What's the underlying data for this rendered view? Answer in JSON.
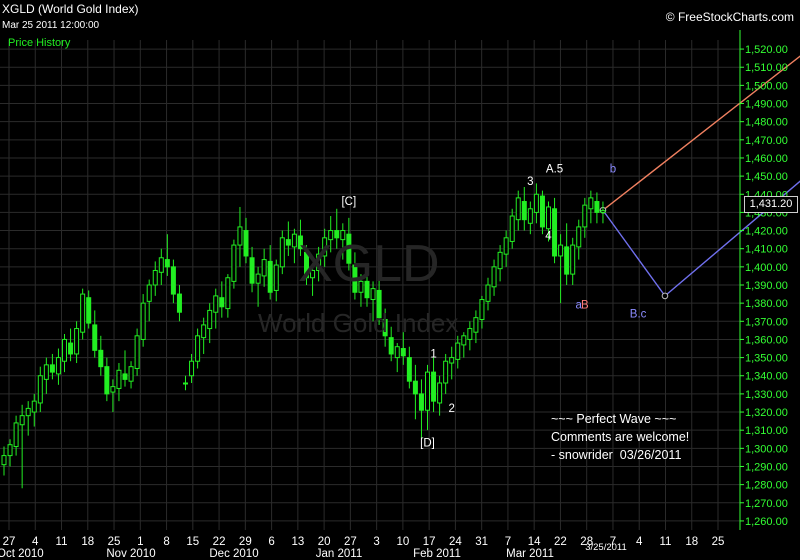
{
  "header": {
    "symbol_title": "XGLD (World Gold Index)",
    "timestamp": "Mar 25 2011 12:00:00",
    "panel_label": "Price History",
    "brand": "© FreeStockCharts.com"
  },
  "watermark": {
    "symbol": "XGLD",
    "name": "World Gold Index"
  },
  "last_price_label": "1,431.20",
  "note_lines": [
    "~~~ Perfect Wave ~~~",
    "Comments are welcome!",
    "- snowrider  03/26/2011"
  ],
  "colors": {
    "background": "#000000",
    "candles": "#22ee22",
    "grid": "#2b2b2b",
    "axis_text": "#33ff33",
    "projection_up": "#f08060",
    "projection_alt": "#7070ee",
    "label_blue": "#8c8cff",
    "label_red": "#ff7a7a"
  },
  "chart_data": {
    "type": "candlestick",
    "ylim": [
      1255,
      1525
    ],
    "y_ticks": [
      1260,
      1270,
      1280,
      1290,
      1300,
      1310,
      1320,
      1330,
      1340,
      1350,
      1360,
      1370,
      1380,
      1390,
      1400,
      1410,
      1420,
      1430,
      1440,
      1450,
      1460,
      1470,
      1480,
      1490,
      1500,
      1510,
      1520
    ],
    "y_tick_labels": [
      "1,260.00",
      "1,270.00",
      "1,280.00",
      "1,290.00",
      "1,300.00",
      "1,310.00",
      "1,320.00",
      "1,330.00",
      "1,340.00",
      "1,350.00",
      "1,360.00",
      "1,370.00",
      "1,380.00",
      "1,390.00",
      "1,400.00",
      "1,410.00",
      "1,420.00",
      "1,430.00",
      "1,440.00",
      "1,450.00",
      "1,460.00",
      "1,470.00",
      "1,480.00",
      "1,490.00",
      "1,500.00",
      "1,510.00",
      "1,520.00"
    ],
    "x_day_ticks": [
      "27",
      "4",
      "11",
      "18",
      "25",
      "1",
      "8",
      "15",
      "22",
      "29",
      "6",
      "13",
      "20",
      "27",
      "3",
      "10",
      "17",
      "24",
      "31",
      "7",
      "14",
      "22",
      "28",
      "7",
      "4",
      "11",
      "18",
      "25"
    ],
    "month_labels": [
      "Oct 2010",
      "Nov 2010",
      "Dec 2010",
      "Jan 2011",
      "Feb 2011",
      "Mar 2011"
    ],
    "date_marker": "3/25/2011",
    "last_price": 1431.2,
    "ohlc": [
      [
        1291,
        1301,
        1285,
        1296
      ],
      [
        1296,
        1305,
        1290,
        1302
      ],
      [
        1301,
        1318,
        1296,
        1314
      ],
      [
        1313,
        1324,
        1278,
        1318
      ],
      [
        1318,
        1326,
        1307,
        1322
      ],
      [
        1320,
        1330,
        1312,
        1326
      ],
      [
        1325,
        1345,
        1320,
        1340
      ],
      [
        1338,
        1350,
        1330,
        1346
      ],
      [
        1346,
        1352,
        1338,
        1342
      ],
      [
        1341,
        1355,
        1335,
        1350
      ],
      [
        1348,
        1363,
        1342,
        1360
      ],
      [
        1358,
        1366,
        1348,
        1352
      ],
      [
        1352,
        1370,
        1347,
        1366
      ],
      [
        1364,
        1388,
        1360,
        1385
      ],
      [
        1383,
        1387,
        1366,
        1369
      ],
      [
        1368,
        1376,
        1350,
        1354
      ],
      [
        1354,
        1362,
        1340,
        1345
      ],
      [
        1345,
        1350,
        1326,
        1330
      ],
      [
        1331,
        1338,
        1320,
        1334
      ],
      [
        1333,
        1347,
        1326,
        1343
      ],
      [
        1341,
        1354,
        1334,
        1338
      ],
      [
        1337,
        1348,
        1333,
        1345
      ],
      [
        1344,
        1366,
        1340,
        1362
      ],
      [
        1360,
        1385,
        1356,
        1380
      ],
      [
        1381,
        1393,
        1370,
        1390
      ],
      [
        1390,
        1403,
        1384,
        1398
      ],
      [
        1397,
        1410,
        1390,
        1405
      ],
      [
        1404,
        1418,
        1395,
        1400
      ],
      [
        1400,
        1404,
        1380,
        1385
      ],
      [
        1385,
        1390,
        1370,
        1375
      ],
      [
        1336,
        1340,
        1332,
        1336
      ],
      [
        1340,
        1352,
        1336,
        1348
      ],
      [
        1348,
        1366,
        1344,
        1362
      ],
      [
        1361,
        1372,
        1352,
        1368
      ],
      [
        1366,
        1380,
        1358,
        1376
      ],
      [
        1375,
        1388,
        1366,
        1384
      ],
      [
        1383,
        1392,
        1372,
        1378
      ],
      [
        1377,
        1396,
        1372,
        1394
      ],
      [
        1392,
        1415,
        1388,
        1412
      ],
      [
        1412,
        1433,
        1400,
        1422
      ],
      [
        1420,
        1427,
        1402,
        1406
      ],
      [
        1405,
        1411,
        1386,
        1391
      ],
      [
        1391,
        1400,
        1378,
        1396
      ],
      [
        1395,
        1410,
        1389,
        1404
      ],
      [
        1403,
        1412,
        1382,
        1386
      ],
      [
        1387,
        1404,
        1381,
        1401
      ],
      [
        1400,
        1420,
        1396,
        1416
      ],
      [
        1415,
        1425,
        1406,
        1412
      ],
      [
        1411,
        1421,
        1402,
        1418
      ],
      [
        1417,
        1426,
        1406,
        1410
      ],
      [
        1408,
        1412,
        1390,
        1394
      ],
      [
        1394,
        1402,
        1384,
        1398
      ],
      [
        1398,
        1411,
        1392,
        1407
      ],
      [
        1406,
        1421,
        1400,
        1416
      ],
      [
        1415,
        1428,
        1408,
        1420
      ],
      [
        1420,
        1432,
        1410,
        1416
      ],
      [
        1415,
        1424,
        1404,
        1420
      ],
      [
        1418,
        1427,
        1398,
        1402
      ],
      [
        1401,
        1408,
        1382,
        1386
      ],
      [
        1386,
        1396,
        1378,
        1392
      ],
      [
        1392,
        1399,
        1378,
        1383
      ],
      [
        1382,
        1392,
        1370,
        1388
      ],
      [
        1387,
        1393,
        1368,
        1372
      ],
      [
        1371,
        1377,
        1356,
        1362
      ],
      [
        1361,
        1367,
        1348,
        1352
      ],
      [
        1350,
        1358,
        1342,
        1356
      ],
      [
        1355,
        1364,
        1346,
        1351
      ],
      [
        1350,
        1356,
        1333,
        1337
      ],
      [
        1337,
        1346,
        1316,
        1330
      ],
      [
        1330,
        1338,
        1306,
        1321
      ],
      [
        1321,
        1346,
        1310,
        1342
      ],
      [
        1342,
        1350,
        1320,
        1326
      ],
      [
        1325,
        1340,
        1318,
        1336
      ],
      [
        1336,
        1352,
        1330,
        1348
      ],
      [
        1347,
        1356,
        1338,
        1350
      ],
      [
        1349,
        1362,
        1344,
        1358
      ],
      [
        1357,
        1364,
        1350,
        1362
      ],
      [
        1360,
        1370,
        1354,
        1366
      ],
      [
        1364,
        1376,
        1358,
        1372
      ],
      [
        1371,
        1384,
        1366,
        1382
      ],
      [
        1381,
        1394,
        1376,
        1390
      ],
      [
        1389,
        1404,
        1384,
        1400
      ],
      [
        1399,
        1412,
        1392,
        1408
      ],
      [
        1407,
        1420,
        1400,
        1416
      ],
      [
        1414,
        1432,
        1410,
        1428
      ],
      [
        1426,
        1442,
        1420,
        1438
      ],
      [
        1436,
        1444,
        1420,
        1426
      ],
      [
        1424,
        1436,
        1418,
        1432
      ],
      [
        1430,
        1446,
        1424,
        1440
      ],
      [
        1439,
        1442,
        1418,
        1422
      ],
      [
        1421,
        1436,
        1414,
        1433
      ],
      [
        1432,
        1438,
        1402,
        1406
      ],
      [
        1406,
        1418,
        1380,
        1412
      ],
      [
        1411,
        1424,
        1390,
        1396
      ],
      [
        1396,
        1416,
        1390,
        1412
      ],
      [
        1411,
        1426,
        1404,
        1422
      ],
      [
        1422,
        1438,
        1416,
        1434
      ],
      [
        1432,
        1442,
        1424,
        1438
      ],
      [
        1436,
        1441,
        1424,
        1430
      ],
      [
        1430,
        1436,
        1424,
        1431
      ]
    ],
    "projections": [
      {
        "name": "primary",
        "points": [
          [
            1431.2,
            0
          ],
          [
            1522,
            17
          ]
        ]
      },
      {
        "name": "alternate",
        "points": [
          [
            1431.2,
            0
          ],
          [
            1384,
            5
          ],
          [
            1500,
            25
          ]
        ]
      }
    ],
    "wave_labels": [
      {
        "text": "[C]",
        "price": 1434,
        "bar": 57,
        "color": "white"
      },
      {
        "text": "1",
        "price": 1350,
        "bar": 71,
        "color": "white"
      },
      {
        "text": "2",
        "price": 1320,
        "bar": 74,
        "color": "white"
      },
      {
        "text": "[D]",
        "price": 1301,
        "bar": 70,
        "color": "white"
      },
      {
        "text": "3",
        "price": 1445,
        "bar": 87,
        "color": "white"
      },
      {
        "text": "A.5",
        "price": 1452,
        "bar": 91,
        "color": "white"
      },
      {
        "text": "4",
        "price": 1415,
        "bar": 90,
        "color": "white"
      },
      {
        "text": "a",
        "price": 1377,
        "bar": 95,
        "color": "blue"
      },
      {
        "text": "B",
        "price": 1377,
        "bar": 96,
        "color": "red"
      },
      {
        "text": "b",
        "price": 1452,
        "bar": 101,
        "color": "blue"
      },
      {
        "text": "B.c",
        "price": 1372,
        "bar": 106,
        "color": "blue"
      }
    ]
  }
}
